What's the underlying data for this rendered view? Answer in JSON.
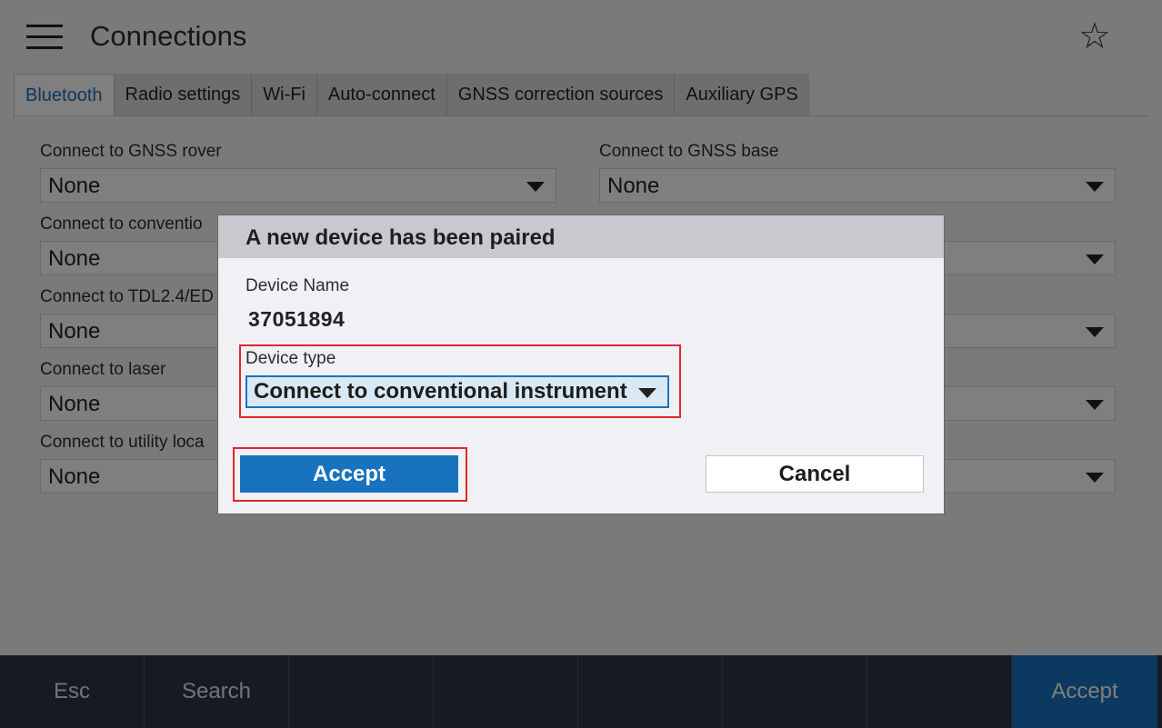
{
  "header": {
    "title": "Connections",
    "menu_icon": "hamburger-menu-icon",
    "favorite_icon": "star-icon"
  },
  "tabs": [
    {
      "label": "Bluetooth",
      "active": true
    },
    {
      "label": "Radio settings"
    },
    {
      "label": "Wi-Fi"
    },
    {
      "label": "Auto-connect"
    },
    {
      "label": "GNSS correction sources"
    },
    {
      "label": "Auxiliary GPS"
    }
  ],
  "left_fields": [
    {
      "label": "Connect to GNSS rover",
      "value": "None"
    },
    {
      "label": "Connect to conventio",
      "value": "None"
    },
    {
      "label": "Connect to TDL2.4/ED",
      "value": "None"
    },
    {
      "label": "Connect to laser",
      "value": "None"
    },
    {
      "label": "Connect to utility loca",
      "value": "None"
    }
  ],
  "right_fields": [
    {
      "label": "Connect to GNSS base",
      "value": "None"
    },
    {
      "label": "",
      "value": ""
    },
    {
      "label": "",
      "value": ""
    },
    {
      "label": "",
      "value": ""
    },
    {
      "label": "",
      "value": ""
    }
  ],
  "dialog": {
    "title": "A new device has been paired",
    "device_name_label": "Device Name",
    "device_name_value": "37051894",
    "device_type_label": "Device type",
    "device_type_value": "Connect to conventional instrument",
    "accept_label": "Accept",
    "cancel_label": "Cancel"
  },
  "softkeys": {
    "esc": "Esc",
    "search": "Search",
    "accept": "Accept"
  },
  "colors": {
    "accent": "#1873bf",
    "highlight": "#e0262f",
    "bottom_bar": "#2e3548"
  }
}
